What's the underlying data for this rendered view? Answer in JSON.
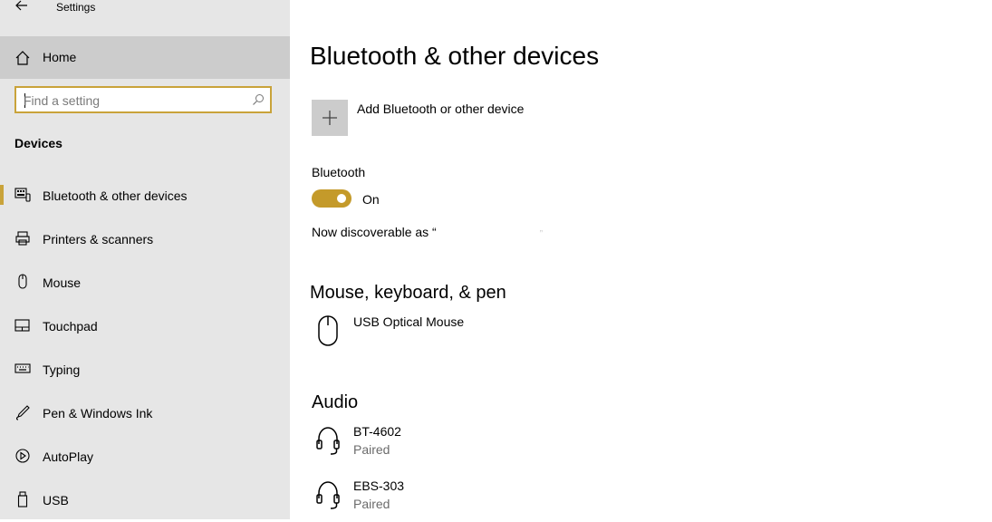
{
  "window": {
    "title": "Settings"
  },
  "sidebar": {
    "home_label": "Home",
    "search": {
      "placeholder": "Find a setting",
      "value": ""
    },
    "section_title": "Devices",
    "items": [
      {
        "label": "Bluetooth & other devices",
        "icon": "bluetooth-devices-icon",
        "selected": true
      },
      {
        "label": "Printers & scanners",
        "icon": "printer-icon",
        "selected": false
      },
      {
        "label": "Mouse",
        "icon": "mouse-icon",
        "selected": false
      },
      {
        "label": "Touchpad",
        "icon": "touchpad-icon",
        "selected": false
      },
      {
        "label": "Typing",
        "icon": "keyboard-icon",
        "selected": false
      },
      {
        "label": "Pen & Windows Ink",
        "icon": "pen-icon",
        "selected": false
      },
      {
        "label": "AutoPlay",
        "icon": "autoplay-icon",
        "selected": false
      },
      {
        "label": "USB",
        "icon": "usb-icon",
        "selected": false
      }
    ]
  },
  "main": {
    "title": "Bluetooth & other devices",
    "add_device_label": "Add Bluetooth or other device",
    "bluetooth": {
      "label": "Bluetooth",
      "state_label": "On",
      "on": true,
      "discoverable_text": "Now discoverable as “",
      "discoverable_name": "",
      "discoverable_close": "”"
    },
    "mouse_section": {
      "title": "Mouse, keyboard, & pen",
      "devices": [
        {
          "name": "USB Optical Mouse",
          "status": "",
          "icon": "mouse-icon"
        }
      ]
    },
    "audio_section": {
      "title": "Audio",
      "devices": [
        {
          "name": "BT-4602",
          "status": "Paired",
          "icon": "headset-icon"
        },
        {
          "name": "EBS-303",
          "status": "Paired",
          "icon": "headset-icon"
        }
      ]
    }
  },
  "colors": {
    "accent": "#c49a2a",
    "sidebar_bg": "#e6e6e6",
    "selected_bg": "#cccccc"
  }
}
